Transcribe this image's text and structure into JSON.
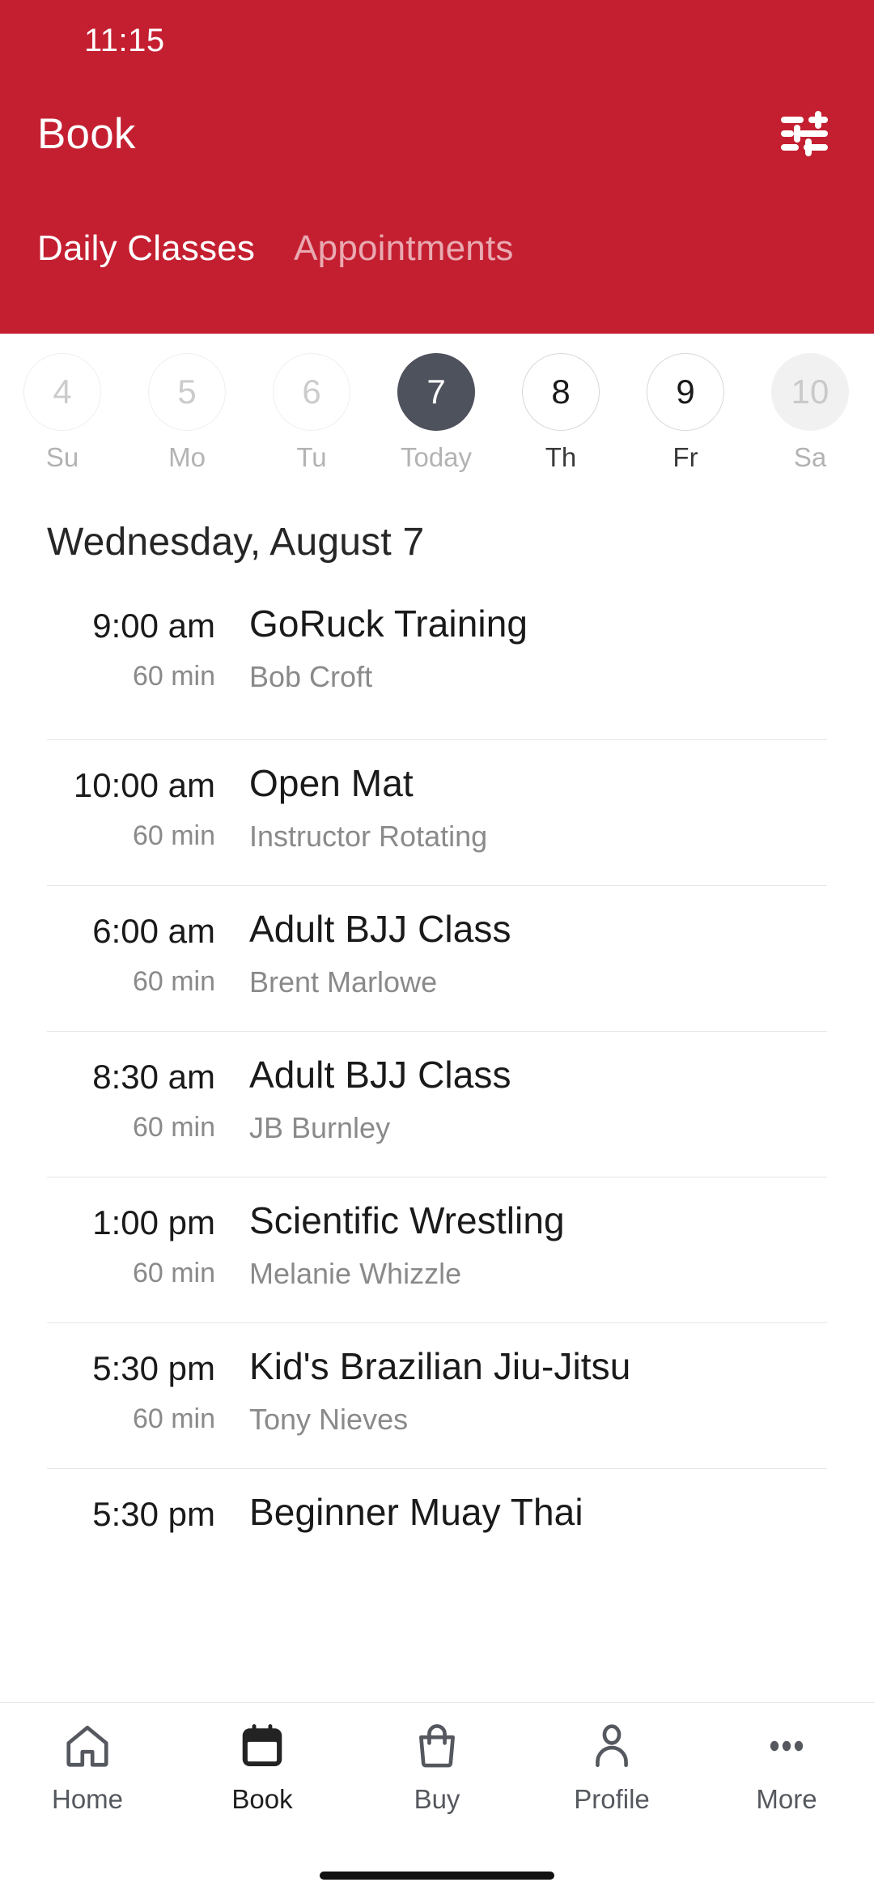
{
  "statusbar": {
    "clock": "11:15"
  },
  "header": {
    "title": "Book",
    "filter_icon": "tune-icon",
    "brand_color": "#C41F31",
    "tabs": [
      {
        "label": "Daily Classes",
        "active": true
      },
      {
        "label": "Appointments",
        "active": false
      }
    ]
  },
  "datestrip": {
    "days": [
      {
        "num": "4",
        "label": "Su",
        "state": "disabled"
      },
      {
        "num": "5",
        "label": "Mo",
        "state": "disabled"
      },
      {
        "num": "6",
        "label": "Tu",
        "state": "disabled"
      },
      {
        "num": "7",
        "label": "Today",
        "state": "today"
      },
      {
        "num": "8",
        "label": "Th",
        "state": "normal"
      },
      {
        "num": "9",
        "label": "Fr",
        "state": "normal"
      },
      {
        "num": "10",
        "label": "Sa",
        "state": "edge"
      }
    ],
    "today_fill_color": "#4E525D"
  },
  "date_heading": "Wednesday, August 7",
  "classes": [
    {
      "time": "9:00 am",
      "duration": "60 min",
      "name": "GoRuck Training",
      "instructor": "Bob Croft"
    },
    {
      "time": "10:00 am",
      "duration": "60 min",
      "name": "Open Mat",
      "instructor": "Instructor Rotating"
    },
    {
      "time": "6:00 am",
      "duration": "60 min",
      "name": "Adult BJJ Class",
      "instructor": "Brent Marlowe"
    },
    {
      "time": "8:30 am",
      "duration": "60 min",
      "name": "Adult BJJ Class",
      "instructor": "JB Burnley"
    },
    {
      "time": "1:00 pm",
      "duration": "60 min",
      "name": "Scientific Wrestling",
      "instructor": "Melanie Whizzle"
    },
    {
      "time": "5:30 pm",
      "duration": "60 min",
      "name": "Kid's Brazilian Jiu-Jitsu",
      "instructor": "Tony Nieves"
    },
    {
      "time": "5:30 pm",
      "duration": "",
      "name": "Beginner Muay Thai",
      "instructor": ""
    }
  ],
  "bottomnav": {
    "items": [
      {
        "label": "Home",
        "icon": "home-icon",
        "active": false
      },
      {
        "label": "Book",
        "icon": "calendar-icon",
        "active": true
      },
      {
        "label": "Buy",
        "icon": "bag-icon",
        "active": false
      },
      {
        "label": "Profile",
        "icon": "person-icon",
        "active": false
      },
      {
        "label": "More",
        "icon": "ellipsis-icon",
        "active": false
      }
    ]
  }
}
